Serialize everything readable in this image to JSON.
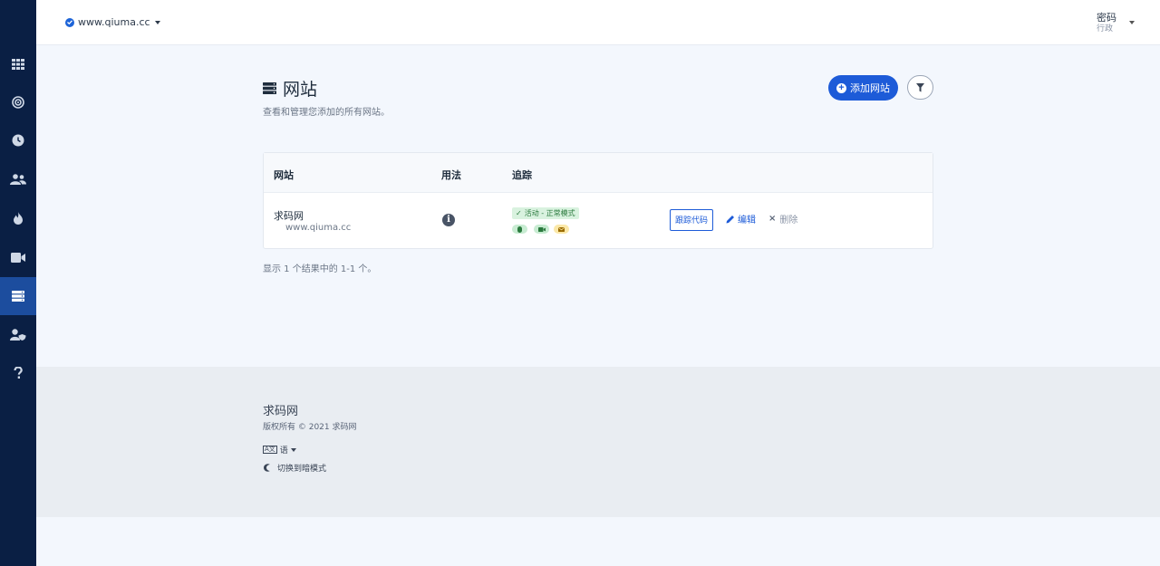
{
  "topbar": {
    "site_name": "www.qiuma.cc",
    "user_name": "密码",
    "user_role": "行政"
  },
  "sidebar": {
    "items": [
      {
        "icon": "grid-icon",
        "active": false
      },
      {
        "icon": "target-icon",
        "active": false
      },
      {
        "icon": "clock-icon",
        "active": false
      },
      {
        "icon": "users-icon",
        "active": false
      },
      {
        "icon": "fire-icon",
        "active": false
      },
      {
        "icon": "video-icon",
        "active": false
      },
      {
        "icon": "server-icon",
        "active": true
      },
      {
        "icon": "user-shield-icon",
        "active": false
      },
      {
        "icon": "help-icon",
        "active": false
      }
    ]
  },
  "header": {
    "title": "网站",
    "subtitle": "查看和管理您添加的所有网站。",
    "add_button": "添加网站"
  },
  "table": {
    "columns": [
      "网站",
      "用法",
      "追踪"
    ],
    "rows": [
      {
        "name": "求码网",
        "url": "www.qiuma.cc",
        "tracking_status": "活动 - 正常模式",
        "code_button": "跟踪代码",
        "edit_label": "编辑",
        "delete_label": "删除"
      }
    ]
  },
  "result_text": "显示 1 个结果中的 1-1 个。",
  "footer": {
    "brand": "求码网",
    "copyright": "版权所有 © 2021 求码网",
    "language_label": "语",
    "dark_mode_label": "切换到暗模式"
  },
  "colors": {
    "sidebar_bg": "#0a1f44",
    "sidebar_active": "#1c4d9e",
    "accent": "#1d5bd8",
    "page_bg": "#f3f7fd",
    "footer_bg": "#e9edf2"
  }
}
